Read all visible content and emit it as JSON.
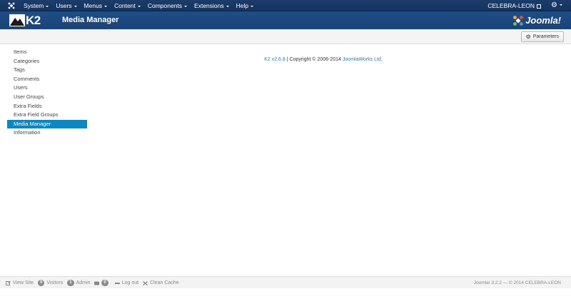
{
  "navbar": {
    "menu": [
      {
        "label": "System",
        "name": "menu-system"
      },
      {
        "label": "Users",
        "name": "menu-users"
      },
      {
        "label": "Menus",
        "name": "menu-menus"
      },
      {
        "label": "Content",
        "name": "menu-content"
      },
      {
        "label": "Components",
        "name": "menu-components"
      },
      {
        "label": "Extensions",
        "name": "menu-extensions"
      },
      {
        "label": "Help",
        "name": "menu-help"
      }
    ],
    "site_name": "CELEBRA-LEON",
    "joomla_icon": "joomla-icon",
    "user_menu_icon": "gear-icon"
  },
  "header": {
    "logo_text": "K2",
    "title": "Media Manager",
    "brand_text": "Joomla!"
  },
  "toolbar": {
    "parameters_label": "Parameters"
  },
  "sidebar": {
    "items": [
      {
        "label": "Items",
        "active": false
      },
      {
        "label": "Categories",
        "active": false
      },
      {
        "label": "Tags",
        "active": false
      },
      {
        "label": "Comments",
        "active": false
      },
      {
        "label": "Users",
        "active": false
      },
      {
        "label": "User Groups",
        "active": false
      },
      {
        "label": "Extra Fields",
        "active": false
      },
      {
        "label": "Extra Field Groups",
        "active": false
      },
      {
        "label": "Media Manager",
        "active": true
      },
      {
        "label": "Information",
        "active": false
      }
    ]
  },
  "credits": {
    "version_link": "K2 v2.6.8",
    "copyright": " | Copyright © 2006-2014 ",
    "company_link": "JoomlaWorks Ltd."
  },
  "footer": {
    "view_site": "View Site",
    "visitors_count": "0",
    "visitors_label": "Visitors",
    "admin_count": "1",
    "admin_label": "Admin",
    "messages_count": "0",
    "logout_label": "Log out",
    "clean_cache": "Clean Cache",
    "version_text": "Joomla! 3.2.2  —  © 2014 CELEBRA-LEON"
  },
  "colors": {
    "navbar": "#15335d",
    "header": "#1a447a",
    "active_item": "#0a87c5",
    "link": "#2a7ab8"
  }
}
